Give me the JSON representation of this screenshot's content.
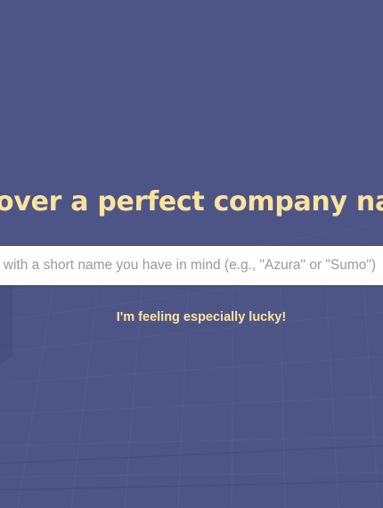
{
  "hero": {
    "headline": "scover a perfect company na",
    "search_placeholder": "rt with a short name you have in mind (e.g., \"Azura\" or \"Sumo\")",
    "lucky_link": "I'm feeling especially lucky!"
  },
  "colors": {
    "background": "#4d5587",
    "accent": "#fde39c",
    "input_bg": "#ffffff",
    "placeholder": "#9a9a9a"
  }
}
